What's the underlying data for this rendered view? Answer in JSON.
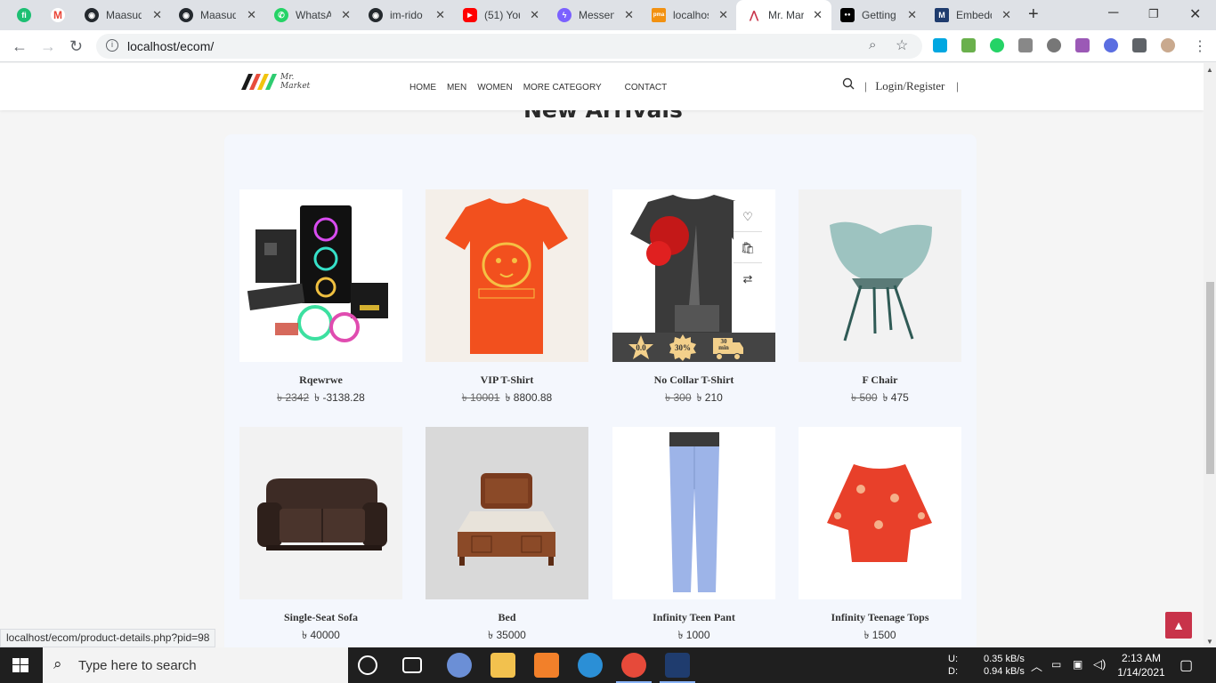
{
  "browser": {
    "tabs": [
      {
        "label": "",
        "icon": "fiverr-icon",
        "color": "#1dbf73",
        "glyph": "fi"
      },
      {
        "label": "",
        "icon": "gmail-icon",
        "color": "#ea4335",
        "glyph": "M"
      },
      {
        "label": "Maasuq",
        "icon": "github-icon",
        "color": "#24292e",
        "glyph": "◉"
      },
      {
        "label": "Maasuq",
        "icon": "github-icon",
        "color": "#24292e",
        "glyph": "◉"
      },
      {
        "label": "WhatsA",
        "icon": "whatsapp-icon",
        "color": "#25d366",
        "glyph": "✆"
      },
      {
        "label": "im-rido",
        "icon": "github-icon",
        "color": "#24292e",
        "glyph": "◉"
      },
      {
        "label": "(51) You",
        "icon": "youtube-icon",
        "color": "#ff0000",
        "glyph": "▶"
      },
      {
        "label": "Messen",
        "icon": "messenger-icon",
        "color": "#7b61ff",
        "glyph": "ϟ"
      },
      {
        "label": "localhos",
        "icon": "phpmyadmin-icon",
        "color": "#f29111",
        "glyph": "pma"
      },
      {
        "label": "Mr. Mar",
        "icon": "mr-market-icon",
        "color": "#c8334a",
        "glyph": "⋀",
        "active": true
      },
      {
        "label": "Getting",
        "icon": "medium-icon",
        "color": "#000000",
        "glyph": "●●"
      },
      {
        "label": "Embedd",
        "icon": "embed-icon",
        "color": "#1f3c6e",
        "glyph": "M"
      }
    ],
    "url": "localhost/ecom/"
  },
  "site": {
    "logo_text_line1": "Mr.",
    "logo_text_line2": "Market",
    "nav": [
      "HOME",
      "MEN",
      "WOMEN",
      "MORE CATEGORY",
      "CONTACT"
    ],
    "login": "Login/Register",
    "login_sep": "|"
  },
  "section": {
    "title": "New Arrivals"
  },
  "products": [
    {
      "name": "Rqewrwe",
      "old_price": "৳ 2342",
      "price": "৳ -3138.28"
    },
    {
      "name": "VIP T-Shirt",
      "old_price": "৳ 10001",
      "price": "৳ 8800.88"
    },
    {
      "name": "No Collar T-Shirt",
      "old_price": "৳ 300",
      "price": "৳ 210",
      "badges": [
        "0.0",
        "30%",
        "30 min"
      ]
    },
    {
      "name": "F Chair",
      "old_price": "৳ 500",
      "price": "৳ 475"
    },
    {
      "name": "Single-Seat Sofa",
      "old_price": "",
      "price": "৳ 40000"
    },
    {
      "name": "Bed",
      "old_price": "",
      "price": "৳ 35000"
    },
    {
      "name": "Infinity Teen Pant",
      "old_price": "",
      "price": "৳ 1000"
    },
    {
      "name": "Infinity Teenage Tops",
      "old_price": "",
      "price": "৳ 1500"
    }
  ],
  "status_url": "localhost/ecom/product-details.php?pid=98",
  "taskbar": {
    "search_placeholder": "Type here to search",
    "net_up_label": "U:",
    "net_down_label": "D:",
    "net_up": "0.35 kB/s",
    "net_down": "0.94 kB/s",
    "time": "2:13 AM",
    "date": "1/14/2021"
  },
  "colors": {
    "accent": "#c8334a",
    "panel": "#f4f7fd"
  }
}
